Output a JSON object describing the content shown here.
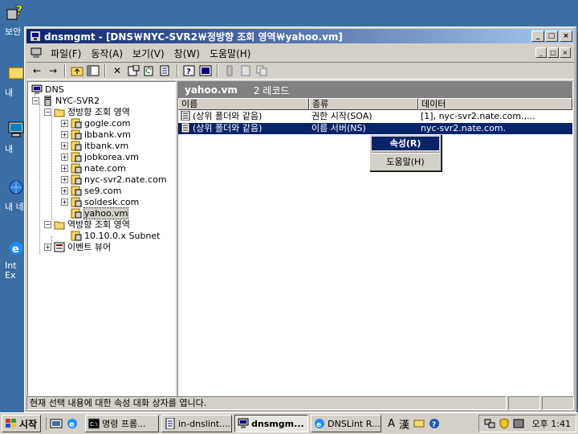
{
  "desktop": {
    "icons": [
      {
        "label": "보안",
        "icon": "help-icon"
      },
      {
        "label": "내",
        "icon": "my-documents-icon"
      },
      {
        "label": "내 ",
        "icon": "my-computer-icon"
      },
      {
        "label": "내 네",
        "icon": "my-network-icon"
      },
      {
        "label": "Int Ex",
        "icon": "internet-explorer-icon"
      }
    ]
  },
  "window": {
    "title": "dnsmgmt - [DNS￦NYC-SVR2￦정방향 조회 영역￦yahoo.vm]",
    "minimize": "_",
    "maximize": "□",
    "close": "×"
  },
  "menubar": {
    "items": [
      "파일(F)",
      "동작(A)",
      "보기(V)",
      "창(W)",
      "도움말(H)"
    ]
  },
  "tree": {
    "root": "DNS",
    "server": "NYC-SVR2",
    "forward_zone": "정방향 조회 영역",
    "zones": [
      "gogle.com",
      "ibbank.vm",
      "itbank.vm",
      "jobkorea.vm",
      "nate.com",
      "nyc-svr2.nate.com",
      "se9.com",
      "soldesk.com",
      "yahoo.vm"
    ],
    "reverse_zone": "역방향 조회 영역",
    "reverse_items": [
      "10.10.0.x Subnet"
    ],
    "event_viewer": "이벤트 뷰어"
  },
  "details": {
    "zone_name": "yahoo.vm",
    "record_count": "2 레코드",
    "columns": [
      "이름",
      "종류",
      "데이터"
    ],
    "rows": [
      {
        "name": "(상위 폴더와 같음)",
        "type": "권한 시작(SOA)",
        "data": "[1], nyc-svr2.nate.com.,...",
        "selected": false
      },
      {
        "name": "(상위 폴더와 같음)",
        "type": "이름 서버(NS)",
        "data": "nyc-svr2.nate.com.",
        "selected": true
      }
    ]
  },
  "context_menu": {
    "items": [
      "속성(R)",
      "도움말(H)"
    ]
  },
  "status": {
    "text": "현재 선택 내용에 대한 속성 대화 상자를 엽니다."
  },
  "taskbar": {
    "start": "시작",
    "tasks": [
      {
        "label": "명령 프롬...",
        "icon": "cmd-icon",
        "active": false
      },
      {
        "label": "in-dnslint....",
        "icon": "document-icon",
        "active": false
      },
      {
        "label": "dnsmgm...",
        "icon": "dns-icon",
        "active": true
      },
      {
        "label": "DNSLint R...",
        "icon": "ie-icon",
        "active": false
      }
    ],
    "ime": [
      "A",
      "漢"
    ],
    "clock": "오후 1:41"
  },
  "colors": {
    "desktop": "#3a6ea5",
    "title_active": "#0a246a",
    "selection": "#0a246a",
    "face": "#d4d0c8"
  }
}
